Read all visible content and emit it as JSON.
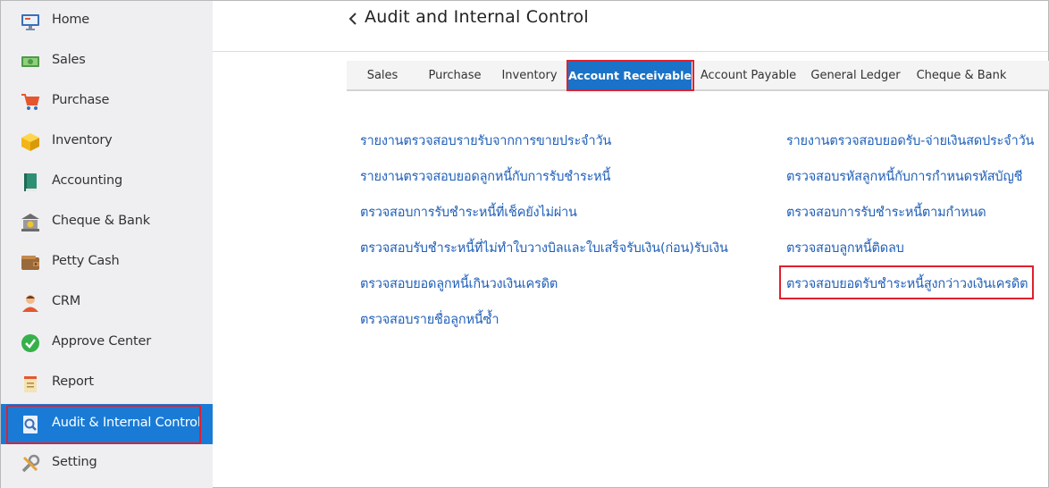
{
  "sidebar": {
    "items": [
      {
        "label": "Home",
        "icon": "monitor-icon"
      },
      {
        "label": "Sales",
        "icon": "money-icon"
      },
      {
        "label": "Purchase",
        "icon": "cart-icon"
      },
      {
        "label": "Inventory",
        "icon": "box-icon"
      },
      {
        "label": "Accounting",
        "icon": "book-icon"
      },
      {
        "label": "Cheque & Bank",
        "icon": "bank-icon"
      },
      {
        "label": "Petty Cash",
        "icon": "wallet-icon"
      },
      {
        "label": "CRM",
        "icon": "people-icon"
      },
      {
        "label": "Approve Center",
        "icon": "check-circle-icon"
      },
      {
        "label": "Report",
        "icon": "report-icon"
      },
      {
        "label": "Audit & Internal Control",
        "icon": "audit-icon"
      },
      {
        "label": "Setting",
        "icon": "tools-icon"
      }
    ],
    "active_index": 10
  },
  "header": {
    "title": "Audit and Internal Control"
  },
  "tabs": [
    {
      "label": "Sales"
    },
    {
      "label": "Purchase"
    },
    {
      "label": "Inventory"
    },
    {
      "label": "Account Receivable"
    },
    {
      "label": "Account Payable"
    },
    {
      "label": "General Ledger"
    },
    {
      "label": "Cheque & Bank"
    }
  ],
  "active_tab": "Account Receivable",
  "reports": {
    "left": [
      "รายงานตรวจสอบรายรับจากการขายประจำวัน",
      "รายงานตรวจสอบยอดลูกหนี้กับการรับชำระหนี้",
      "ตรวจสอบการรับชำระหนี้ที่เช็คยังไม่ผ่าน",
      "ตรวจสอบรับชำระหนี้ที่ไม่ทำใบวางบิลและใบเสร็จรับเงิน(ก่อน)รับเงิน",
      "ตรวจสอบยอดลูกหนี้เกินวงเงินเครดิต",
      "ตรวจสอบรายชื่อลูกหนี้ซ้ำ"
    ],
    "right": [
      "รายงานตรวจสอบยอดรับ-จ่ายเงินสดประจำวัน",
      "ตรวจสอบรหัสลูกหนี้กับการกำหนดรหัสบัญชี",
      "ตรวจสอบการรับชำระหนี้ตามกำหนด",
      "ตรวจสอบลูกหนี้ติดลบ",
      "ตรวจสอบยอดรับชำระหนี้สูงกว่าวงเงินเครดิต"
    ]
  },
  "colors": {
    "sidebar_bg": "#efeff2",
    "active_blue": "#1a7bd6",
    "tab_active_blue": "#1a73c8",
    "link_blue": "#1f5fb8",
    "highlight_red": "#e0202e"
  }
}
